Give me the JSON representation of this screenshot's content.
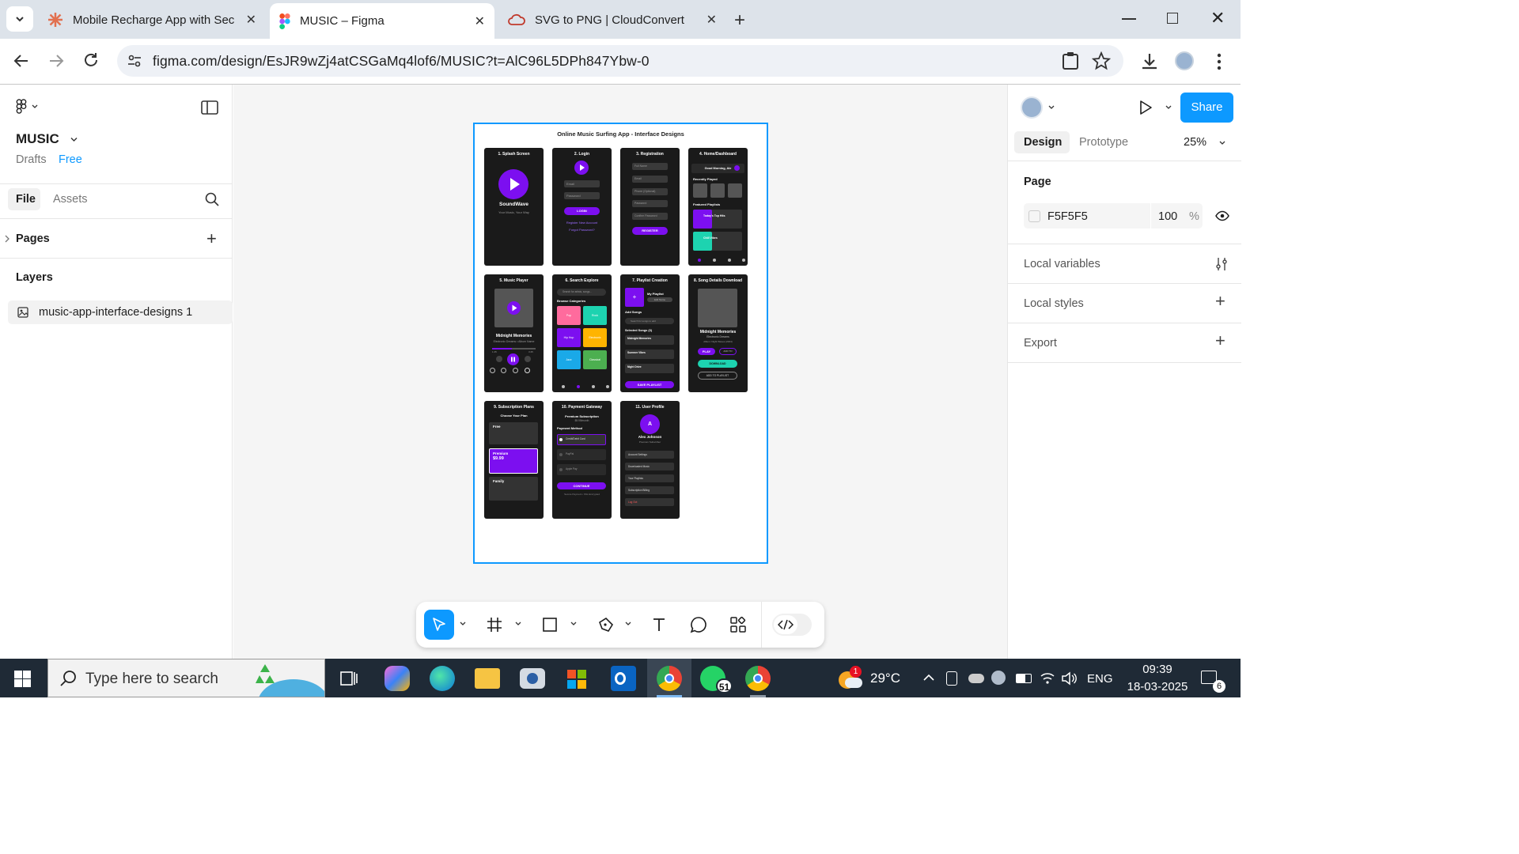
{
  "browser": {
    "tabs": [
      {
        "title": "Mobile Recharge App with Secu"
      },
      {
        "title": "MUSIC – Figma"
      },
      {
        "title": "SVG to PNG | CloudConvert"
      }
    ],
    "url": "figma.com/design/EsJR9wZj4atCSGaMq4lof6/MUSIC?t=AlC96L5DPh847Ybw-0"
  },
  "figma": {
    "file_name": "MUSIC",
    "drafts": "Drafts",
    "plan": "Free",
    "tab_file": "File",
    "tab_assets": "Assets",
    "pages_label": "Pages",
    "layers_label": "Layers",
    "layer_item": "music-app-interface-designs 1",
    "right": {
      "tab_design": "Design",
      "tab_prototype": "Prototype",
      "zoom": "25%",
      "share": "Share",
      "page_label": "Page",
      "page_color": "F5F5F5",
      "page_opacity": "100",
      "percent": "%",
      "local_variables": "Local variables",
      "local_styles": "Local styles",
      "export": "Export"
    }
  },
  "design": {
    "title": "Online Music Surfing App - Interface Designs",
    "screens": {
      "s1": {
        "title": "1. Splash Screen",
        "brand": "SoundWave",
        "tagline": "Your Music, Your Way"
      },
      "s2": {
        "title": "2. Login",
        "email": "Email",
        "password": "Password",
        "button": "LOGIN",
        "link1": "Register New Account",
        "link2": "Forgot Password?"
      },
      "s3": {
        "title": "3. Registration",
        "f1": "Full Name",
        "f2": "Email",
        "f3": "Phone (Optional)",
        "f4": "Password",
        "f5": "Confirm Password",
        "button": "REGISTER"
      },
      "s4": {
        "title": "4. Home/Dashboard",
        "greet": "Good Morning, Ale",
        "recent": "Recently Played",
        "featured": "Featured Playlists",
        "p1": "Today's Top Hits",
        "p2": "Chill Vibes"
      },
      "s5": {
        "title": "5. Music Player",
        "song": "Midnight Memories",
        "artist": "Electronic Dreams • Album Name",
        "t1": "1:45",
        "t2": "3:45"
      },
      "s6": {
        "title": "6. Search Explore",
        "search": "Search for artists, songs...",
        "browse": "Browse Categories",
        "c1": "Pop",
        "c2": "Rock",
        "c3": "Hip Hop",
        "c4": "Electronic",
        "c5": "Jazz",
        "c6": "Classical"
      },
      "s7": {
        "title": "7. Playlist Creation",
        "playlist": "My Playlist",
        "edit": "Edit Name",
        "add": "Add Songs",
        "search": "Search for songs to add",
        "selected": "Selected Songs (3)",
        "song1": "Midnight Memories",
        "song2": "Summer Vibes",
        "song3": "Night Drive",
        "button": "SAVE PLAYLIST"
      },
      "s8": {
        "title": "8. Song Details Download",
        "song": "Midnight Memories",
        "artist": "Electronic Dreams",
        "album": "Album: Night Waves (2024)",
        "play": "PLAY",
        "add": "ADD TO",
        "download": "DOWNLOAD",
        "playlist": "ADD TO PLAYLIST"
      },
      "s9": {
        "title": "9. Subscription Plans",
        "choose": "Choose Your Plan",
        "free": "Free",
        "premium": "Premium",
        "price": "$9.99",
        "family": "Family"
      },
      "s10": {
        "title": "10. Payment Gateway",
        "sub": "Premium Subscription",
        "price": "$9.99/month",
        "method": "Payment Method",
        "m1": "Credit/Debit Card",
        "m2": "PayPal",
        "m3": "Apple Pay",
        "button": "CONTINUE",
        "secure": "Secure Payment • SSL Encrypted"
      },
      "s11": {
        "title": "11. User Profile",
        "avatar": "A",
        "name": "Alex Johnson",
        "sub": "Premium Subscriber",
        "i1": "Account Settings",
        "i2": "Downloaded Music",
        "i3": "Your Playlists",
        "i4": "Subscription Billing",
        "i5": "Log Out"
      }
    }
  },
  "taskbar": {
    "search_placeholder": "Type here to search",
    "weather": "29°C",
    "lang": "ENG",
    "time": "09:39",
    "date": "18-03-2025",
    "whatsapp_badge": "51",
    "notif_count": "6",
    "weather_badge": "1"
  }
}
